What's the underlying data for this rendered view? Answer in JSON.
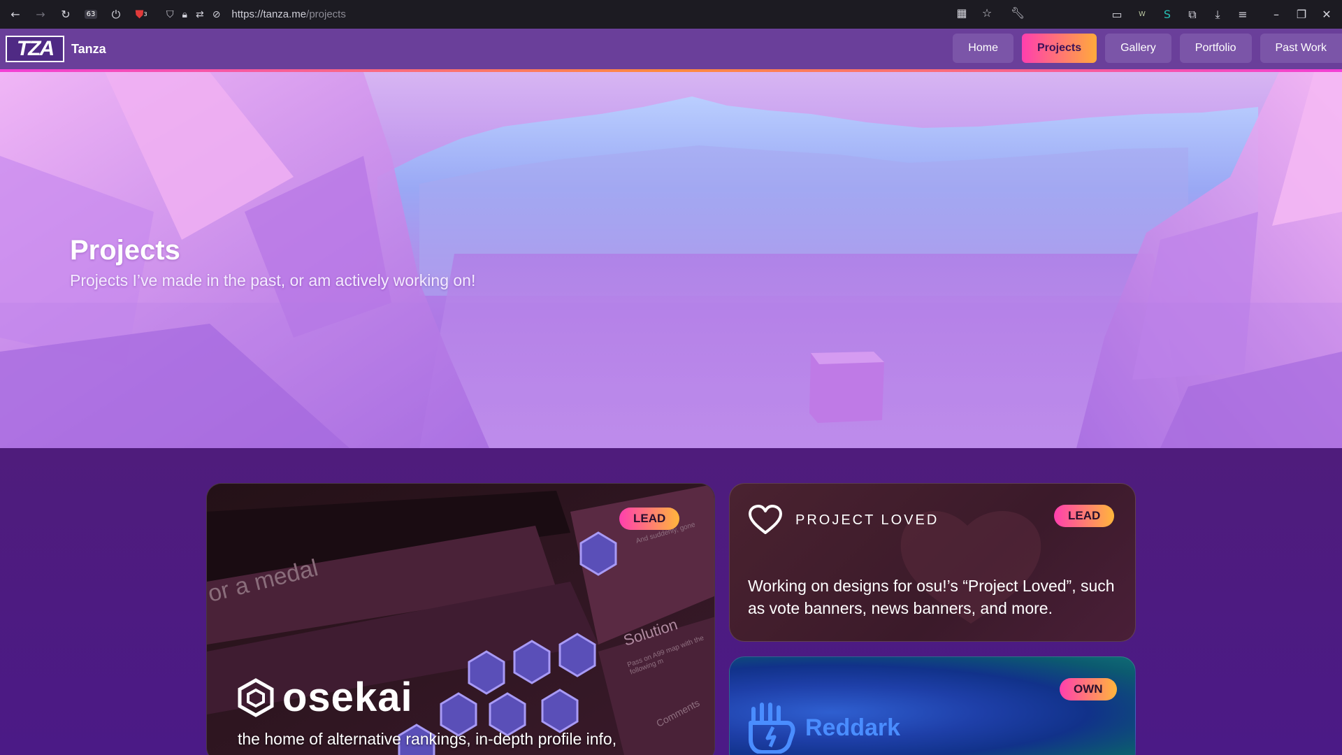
{
  "browser": {
    "url_host": "https://tanza.me",
    "url_path": "/projects",
    "tab_count": "63",
    "ublock_count": "3",
    "icons": [
      "back-icon",
      "forward-icon",
      "reload-icon",
      "tabs-counter-icon",
      "power-icon",
      "ublock-icon",
      "shield-icon",
      "lock-icon",
      "permissions-icon",
      "tracking-icon",
      "grid-icon",
      "star-icon",
      "wrench-icon",
      "reader-icon",
      "wise-extension-icon",
      "skype-extension-icon",
      "extensions-icon",
      "download-icon",
      "menu-icon",
      "minimize-icon",
      "restore-icon",
      "close-icon"
    ]
  },
  "site": {
    "logo_text": "TZA",
    "brand": "Tanza",
    "nav": [
      {
        "label": "Home",
        "active": false
      },
      {
        "label": "Projects",
        "active": true
      },
      {
        "label": "Gallery",
        "active": false
      },
      {
        "label": "Portfolio",
        "active": false
      },
      {
        "label": "Past Work",
        "active": false
      }
    ]
  },
  "hero": {
    "title": "Projects",
    "subtitle": "Projects I’ve made in the past, or am actively working on!"
  },
  "cards": {
    "osekai": {
      "tag": "LEAD",
      "name": "osekai",
      "desc": "the home of alternative rankings, in-depth profile info,",
      "screenshot_text": [
        "or a medal",
        "Solution",
        "Pass on A99 map with the following m",
        "Comments",
        "And suddenly, gone"
      ]
    },
    "loved": {
      "tag": "LEAD",
      "title": "PROJECT LOVED",
      "desc": "Working on designs for osu!’s “Project Loved”, such as vote banners, news banners, and more."
    },
    "reddark": {
      "tag": "OWN",
      "name": "Reddark"
    }
  },
  "colors": {
    "accent_gradient_start": "#ff3fae",
    "accent_gradient_end": "#ffb63b",
    "header_bg": "#6a3f9a",
    "content_bg": "#4b1a86",
    "reddark_blue": "#4a8dff"
  }
}
